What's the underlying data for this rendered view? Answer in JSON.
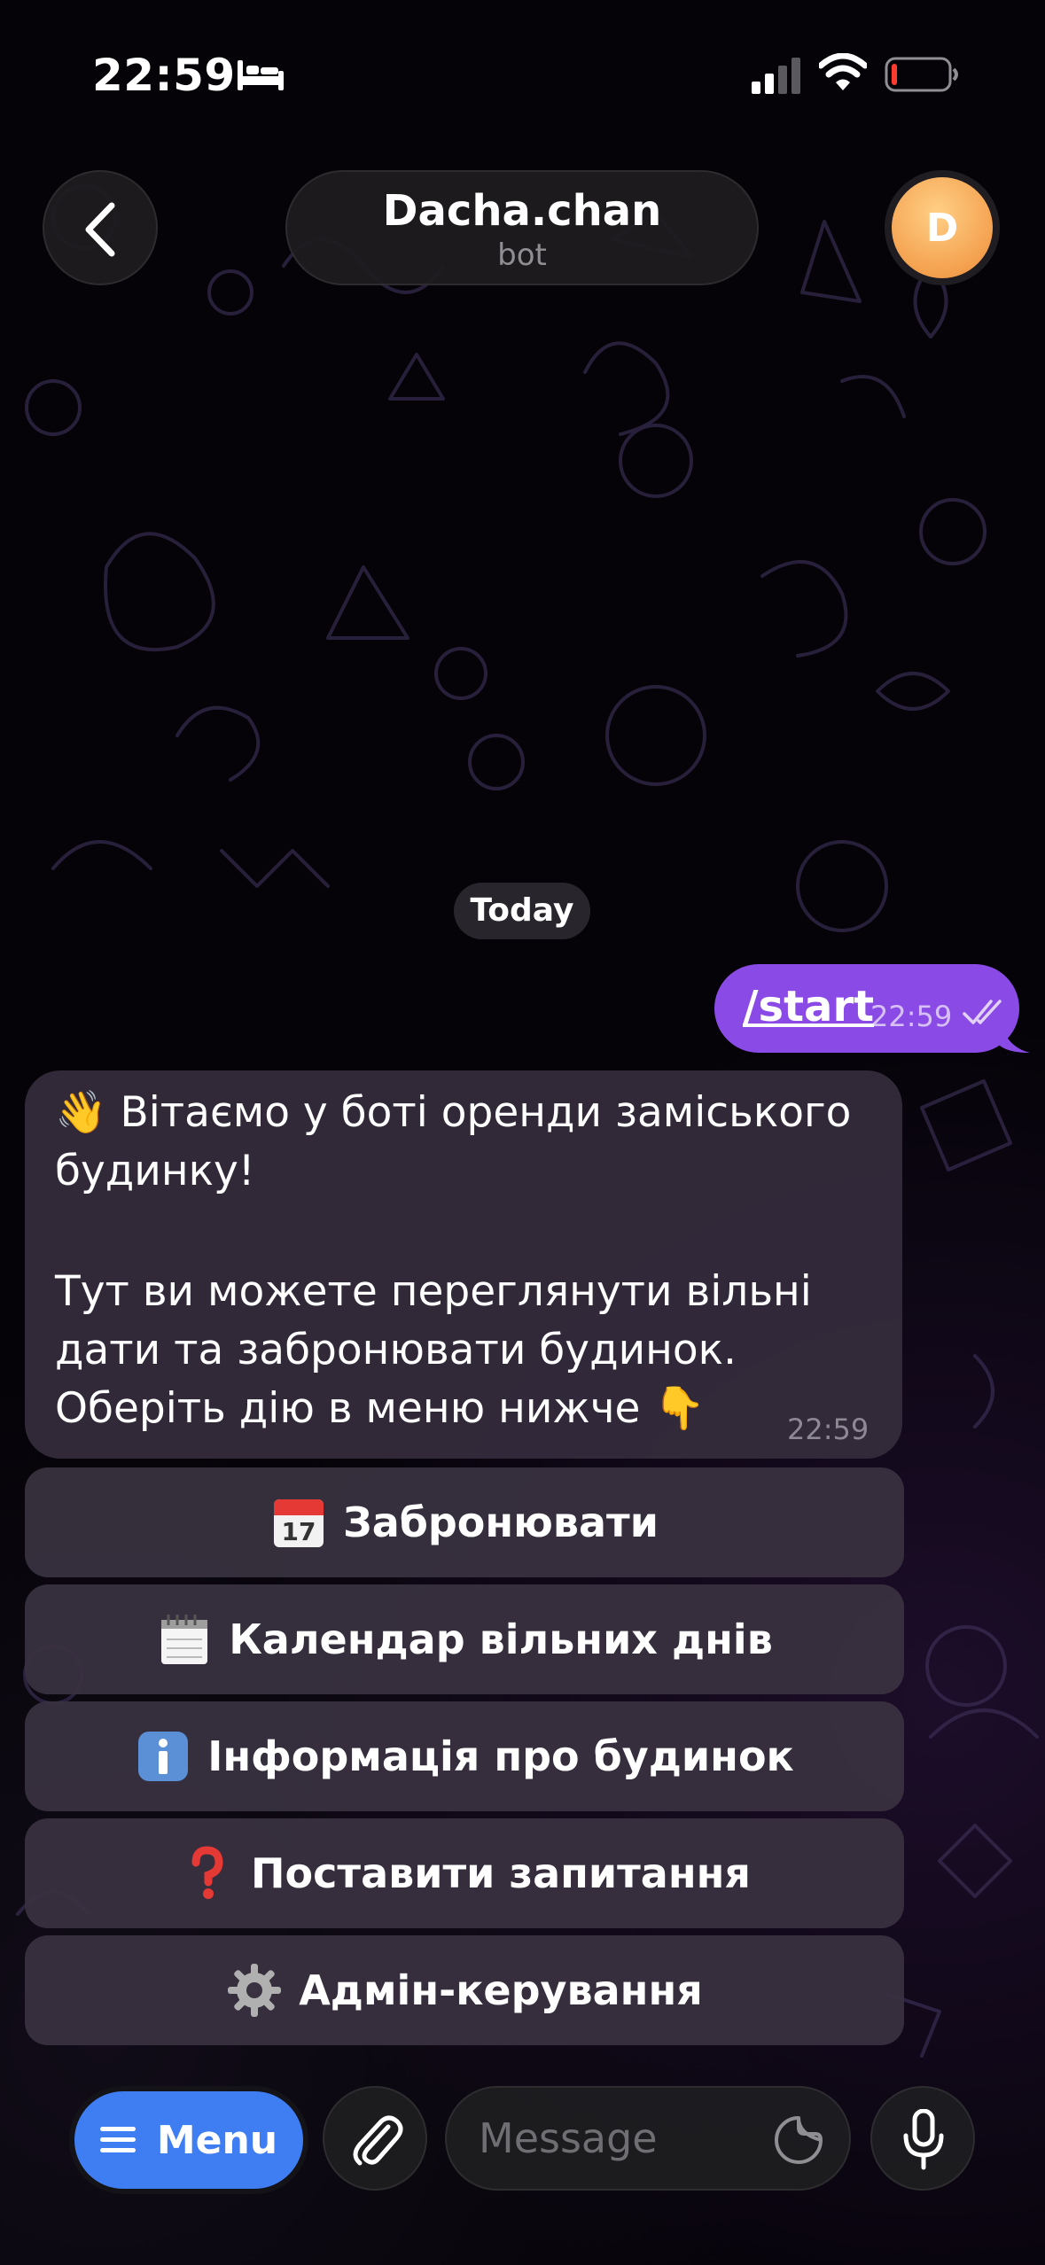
{
  "status_bar": {
    "time": "22:59"
  },
  "header": {
    "title": "Dacha.chan",
    "subtitle": "bot",
    "avatar_initial": "D"
  },
  "chat": {
    "date_label": "Today",
    "outgoing": {
      "text": "/start",
      "time": "22:59"
    },
    "incoming": {
      "lines": [
        "👋 Вітаємо у боті оренди заміського",
        "будинку!",
        "Тут ви можете переглянути вільні",
        "дати та забронювати будинок.",
        "Оберіть дію в меню нижче 👇"
      ],
      "time": "22:59"
    }
  },
  "keyboard": {
    "buttons": [
      {
        "icon": "calendar-17-icon",
        "label": "Забронювати"
      },
      {
        "icon": "spiral-calendar-icon",
        "label": "Календар вільних днів"
      },
      {
        "icon": "information-icon",
        "label": "Інформація про будинок"
      },
      {
        "icon": "question-mark-icon",
        "label": "Поставити запитання"
      },
      {
        "icon": "gear-icon",
        "label": "Адмін-керування"
      }
    ]
  },
  "input_bar": {
    "menu_label": "Menu",
    "placeholder": "Message"
  },
  "colors": {
    "outgoing_bubble": "#8a4ae6",
    "menu_button": "#3f7ef2",
    "incoming_bubble": "#342c3c"
  }
}
